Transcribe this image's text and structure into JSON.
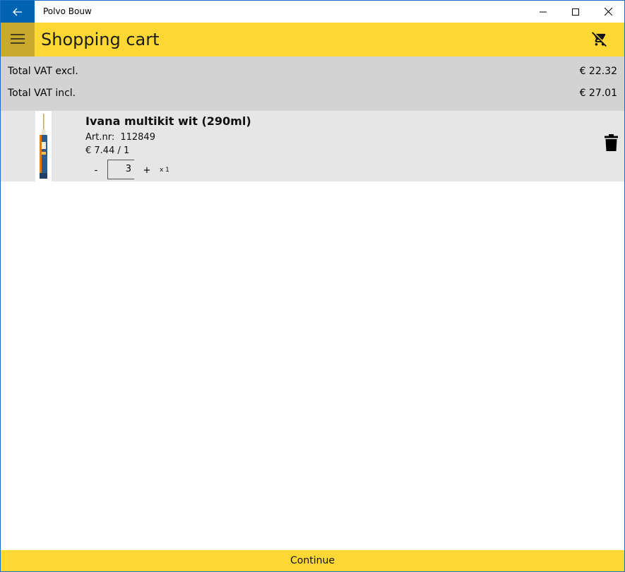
{
  "window": {
    "title": "Polvo Bouw"
  },
  "header": {
    "title": "Shopping cart"
  },
  "totals": {
    "vat_excl_label": "Total VAT excl.",
    "vat_excl_value": "€ 22.32",
    "vat_incl_label": "Total VAT incl.",
    "vat_incl_value": "€ 27.01"
  },
  "cart": {
    "items": [
      {
        "name": "Ivana multikit wit (290ml)",
        "art_label": "Art.nr:",
        "art_number": "112849",
        "price": "€ 7.44 / 1",
        "minus_label": "-",
        "quantity": "3",
        "plus_label": "+",
        "unit": "x 1"
      }
    ]
  },
  "footer": {
    "continue_label": "Continue"
  },
  "icons": {
    "back": "arrow-left-icon",
    "menu": "hamburger-icon",
    "clear_cart": "remove-shopping-cart-icon",
    "delete": "trash-icon"
  },
  "colors": {
    "accent_yellow": "#fdd835",
    "hamburger_bg": "#c9a92b",
    "titlebar_back": "#0063b1",
    "totals_bg": "#d3d3d3",
    "item_bg": "#e6e6e6"
  }
}
